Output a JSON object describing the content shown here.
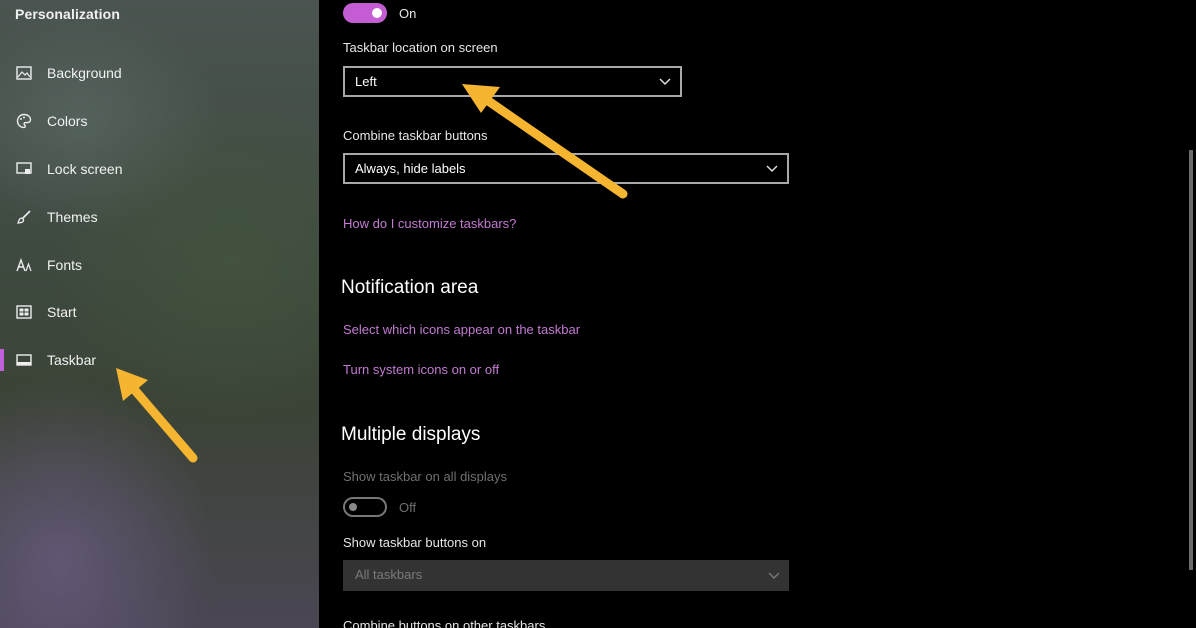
{
  "sidebar": {
    "title": "Personalization",
    "items": [
      {
        "label": "Background",
        "icon": "image-icon"
      },
      {
        "label": "Colors",
        "icon": "palette-icon"
      },
      {
        "label": "Lock screen",
        "icon": "lock-screen-icon"
      },
      {
        "label": "Themes",
        "icon": "themes-brush-icon"
      },
      {
        "label": "Fonts",
        "icon": "fonts-icon"
      },
      {
        "label": "Start",
        "icon": "start-icon"
      },
      {
        "label": "Taskbar",
        "icon": "taskbar-icon",
        "active": true
      }
    ]
  },
  "main": {
    "top_toggle": {
      "state": "On"
    },
    "taskbar_location": {
      "label": "Taskbar location on screen",
      "value": "Left"
    },
    "combine_buttons": {
      "label": "Combine taskbar buttons",
      "value": "Always, hide labels"
    },
    "customize_link": "How do I customize taskbars?",
    "notification_area": {
      "title": "Notification area",
      "links": [
        "Select which icons appear on the taskbar",
        "Turn system icons on or off"
      ]
    },
    "multiple_displays": {
      "title": "Multiple displays",
      "show_all_label": "Show taskbar on all displays",
      "show_all_state": "Off",
      "buttons_on_label": "Show taskbar buttons on",
      "buttons_on_value": "All taskbars",
      "combine_other_label": "Combine buttons on other taskbars"
    }
  },
  "colors": {
    "accent": "#c45cd4",
    "link": "#c27ad2",
    "arrow": "#f5b531"
  }
}
